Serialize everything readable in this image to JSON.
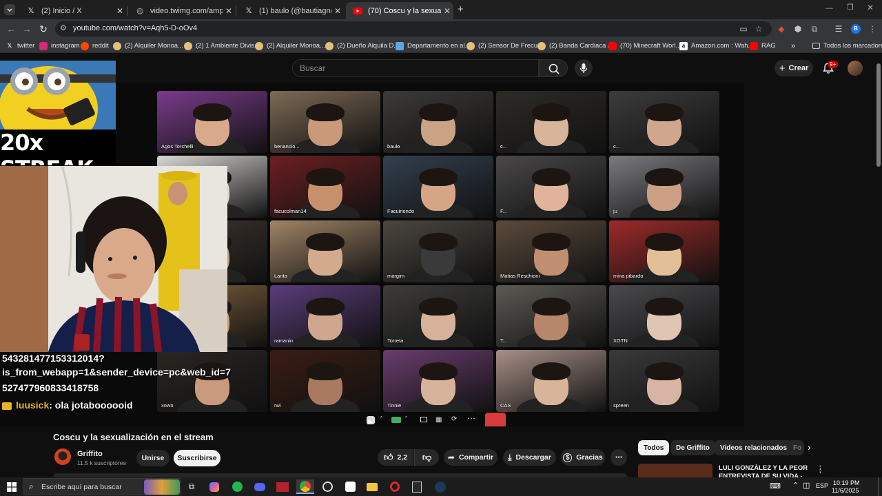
{
  "browser": {
    "tabs": [
      {
        "label": "(2) Inicio / X",
        "icon": "x-logo-icon",
        "active": false
      },
      {
        "label": "video.twimg.com/amplify_video",
        "icon": "globe-icon",
        "active": false
      },
      {
        "label": "(1) baulo (@bautiagnone) / X",
        "icon": "x-logo-icon",
        "active": false
      },
      {
        "label": "(70) Coscu y la sexualización en",
        "icon": "youtube-icon",
        "active": true
      }
    ],
    "new_tab": "+",
    "url": "youtube.com/watch?v=Aqh5-D-oOv4",
    "profile_initial": "B",
    "bookmarks": [
      {
        "label": "twitter",
        "icon": "x-logo-icon",
        "color": "#000000"
      },
      {
        "label": "instagram",
        "icon": "instagram-icon",
        "color": "#d62976"
      },
      {
        "label": "reddit",
        "icon": "reddit-icon",
        "color": "#ff4500"
      },
      {
        "label": "(2) Alquiler Monoa...",
        "icon": "marketplace-icon",
        "color": "#e5c07b"
      },
      {
        "label": "(2) 1 Ambiente Divis...",
        "icon": "marketplace-icon",
        "color": "#e5c07b"
      },
      {
        "label": "(2) Alquiler Monoa...",
        "icon": "marketplace-icon",
        "color": "#e5c07b"
      },
      {
        "label": "(2) Dueño Alquila D...",
        "icon": "marketplace-icon",
        "color": "#e5c07b"
      },
      {
        "label": "Departamento en al...",
        "icon": "realestate-icon",
        "color": "#5aa9e6"
      },
      {
        "label": "(2) Sensor De Frecu...",
        "icon": "marketplace-icon",
        "color": "#e5c07b"
      },
      {
        "label": "(2) Banda Cardiaca J...",
        "icon": "marketplace-icon",
        "color": "#e5c07b"
      },
      {
        "label": "(70) Minecraft Worl...",
        "icon": "youtube-icon",
        "color": "#ff0000"
      },
      {
        "label": "Amazon.com : Wah...",
        "icon": "amazon-icon",
        "color": "#ffffff"
      },
      {
        "label": "RAG",
        "icon": "youtube-icon",
        "color": "#ff0000"
      }
    ],
    "bookmarks_more": "»",
    "all_bookmarks": "Todos los marcadores"
  },
  "youtube": {
    "search_placeholder": "Buscar",
    "create_label": "Crear",
    "notifications_badge": "9+",
    "video": {
      "title": "Coscu y la sexualización en el stream",
      "channel": "Griffito",
      "subscribers": "11.5 k suscriptores",
      "join_label": "Unirse",
      "subscribe_label": "Suscribirse",
      "likes": "2,2",
      "share_label": "Compartir",
      "download_label": "Descargar",
      "thanks_label": "Gracias"
    },
    "chips": [
      "Todos",
      "De Griffito",
      "Videos relacionados",
      "Fo"
    ],
    "recommended": {
      "title": "LULI GONZÁLEZ Y LA PEOR ENTREVISTA DE SU VIDA -"
    }
  },
  "stream": {
    "streak_text": "20x STREAK",
    "chat_lines": [
      "543281477153312014?",
      "is_from_webapp=1&sender_device=pc&web_id=7",
      "527477960833418758"
    ],
    "chat_user": "luusick",
    "chat_message": ": ola jotaboooooid",
    "participants": [
      {
        "name": "Agos Torchelli",
        "bg": "#7a3b8c",
        "skin": "#d8a98a"
      },
      {
        "name": "benancio...",
        "bg": "#7e6a56",
        "skin": "#c9997a"
      },
      {
        "name": "baulo",
        "bg": "#3d3a37",
        "skin": "#c9a384"
      },
      {
        "name": "c...",
        "bg": "#2e2b27",
        "skin": "#d8b49a"
      },
      {
        "name": "c...",
        "bg": "#3c3c3c",
        "skin": "#d1a68e"
      },
      {
        "name": "",
        "bg": "#d9d6d3",
        "skin": "#d9d6d3"
      },
      {
        "name": "facucolman14",
        "bg": "#6c1f22",
        "skin": "#c6906c"
      },
      {
        "name": "Facuiriondo",
        "bg": "#33404f",
        "skin": "#d4a685"
      },
      {
        "name": "F...",
        "bg": "#4a4848",
        "skin": "#e1b39a"
      },
      {
        "name": "ju",
        "bg": "#7a7a80",
        "skin": "#cda086"
      },
      {
        "name": "",
        "bg": "#3f352f",
        "skin": "#c99a7c"
      },
      {
        "name": "Larita",
        "bg": "#a08466",
        "skin": "#d4aa8c"
      },
      {
        "name": "margim",
        "bg": "#4b463f",
        "skin": "#3a3a3a"
      },
      {
        "name": "Matias Reschioni",
        "bg": "#5b4a3c",
        "skin": "#c08e70"
      },
      {
        "name": "mina pibardo",
        "bg": "#9e2a2a",
        "skin": "#e2bf96"
      },
      {
        "name": "",
        "bg": "#80613f",
        "skin": "#c99a7c"
      },
      {
        "name": "ramanin",
        "bg": "#5a3d7a",
        "skin": "#cfa78f"
      },
      {
        "name": "Torreta",
        "bg": "#3d3c3a",
        "skin": "#d8b19a"
      },
      {
        "name": "T...",
        "bg": "#5c5a54",
        "skin": "#b6876a"
      },
      {
        "name": "XGTN",
        "bg": "#4a4a4e",
        "skin": "#e0c4b4"
      },
      {
        "name": "xown",
        "bg": "#2a2622",
        "skin": "#c99a7c"
      },
      {
        "name": "rwi",
        "bg": "#3a1d14",
        "skin": "#aa7a60"
      },
      {
        "name": "Tinnie",
        "bg": "#6a3d6e",
        "skin": "#d7b39c"
      },
      {
        "name": "CAS",
        "bg": "#a88e87",
        "skin": "#d8b49a"
      },
      {
        "name": "spreen",
        "bg": "#3a3a3a",
        "skin": "#d8b4a4"
      }
    ]
  },
  "taskbar": {
    "search_placeholder": "Escribe aquí para buscar",
    "language": "ESP",
    "time": "10:19 PM",
    "date": "11/6/2025"
  }
}
